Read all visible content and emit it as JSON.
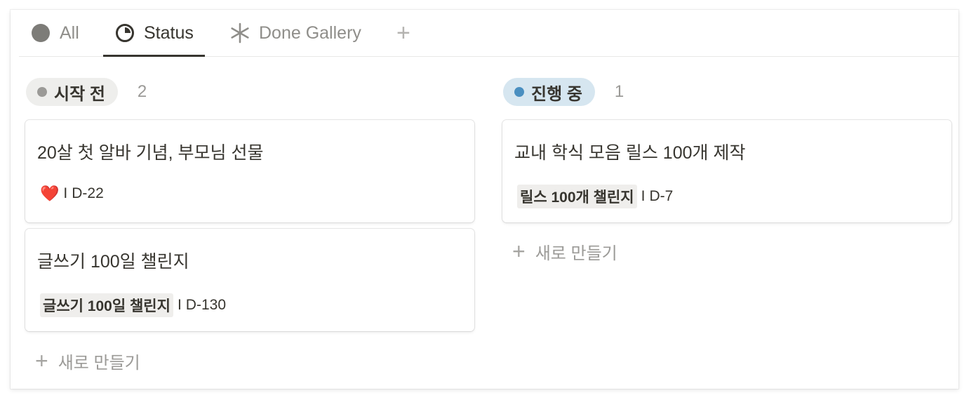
{
  "tabs": [
    {
      "label": "All",
      "icon": "circle-filled-icon",
      "active": false
    },
    {
      "label": "Status",
      "icon": "pie-chart-icon",
      "active": true
    },
    {
      "label": "Done Gallery",
      "icon": "asterisk-icon",
      "active": false
    }
  ],
  "add_tab": "+",
  "columns": [
    {
      "status": "시작 전",
      "count": "2",
      "pill_color": "#eeeeec",
      "dot_color": "#9b9a97",
      "cards": [
        {
          "title": "20살 첫 알바 기념, 부모님 선물",
          "icon": "heart-icon",
          "tag": "",
          "separator": "I",
          "dday": "D-22"
        },
        {
          "title": "글쓰기 100일 챌린지",
          "icon": "",
          "tag": "글쓰기 100일 챌린지",
          "separator": "I",
          "dday": "D-130"
        }
      ],
      "new_label": "새로 만들기"
    },
    {
      "status": "진행 중",
      "count": "1",
      "pill_color": "#d6e6f0",
      "dot_color": "#4a8fc0",
      "cards": [
        {
          "title": "교내 학식 모음 릴스 100개 제작",
          "icon": "",
          "tag": "릴스 100개 챌린지",
          "separator": "I",
          "dday": "D-7"
        }
      ],
      "new_label": "새로 만들기"
    }
  ],
  "heart_glyph": "❤️"
}
